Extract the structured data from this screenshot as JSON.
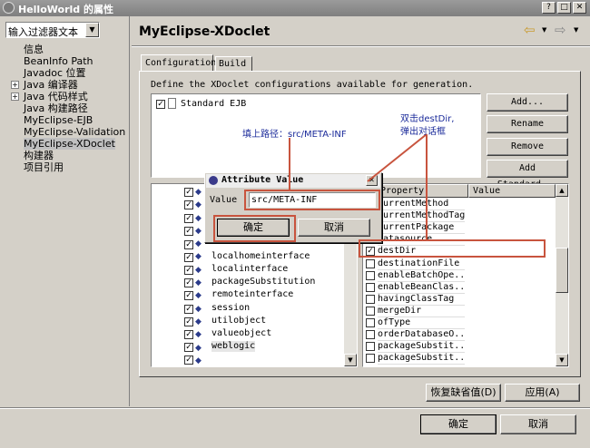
{
  "window": {
    "title": "HelloWorld 的属性"
  },
  "filter": {
    "value": "输入过滤器文本"
  },
  "nav": {
    "items": [
      "信息",
      "BeanInfo Path",
      "Javadoc 位置",
      "Java 编译器",
      "Java 代码样式",
      "Java 构建路径",
      "MyEclipse-EJB",
      "MyEclipse-Validation",
      "MyEclipse-XDoclet",
      "构建器",
      "项目引用"
    ]
  },
  "page": {
    "title": "MyEclipse-XDoclet"
  },
  "tabs": {
    "configuration": "Configuration",
    "build": "Build"
  },
  "main": {
    "description": "Define the XDoclet configurations available for generation.",
    "config_item": "Standard EJB",
    "buttons": {
      "add": "Add...",
      "rename": "Rename",
      "remove": "Remove",
      "add_standard": "Add Standard..."
    }
  },
  "left_list": {
    "items": [
      "localhomeinterface",
      "localinterface",
      "packageSubstitution",
      "remoteinterface",
      "session",
      "utilobject",
      "valueobject",
      "weblogic"
    ]
  },
  "props": {
    "header_property": "Property",
    "header_value": "Value",
    "rows": [
      "currentMethod",
      "currentMethodTag",
      "currentPackage",
      "datasource",
      "destDir",
      "destinationFile",
      "enableBatchOpe...",
      "enableBeanClas...",
      "havingClassTag",
      "mergeDir",
      "ofType",
      "orderDatabaseO...",
      "packageSubstit...",
      "packageSubstit..."
    ]
  },
  "dialog": {
    "title": "Attribute Value",
    "label": "Value :",
    "value": "src/META-INF",
    "ok": "确定",
    "cancel": "取消"
  },
  "annotations": {
    "fill_path": "填上路径：src/META-INF",
    "double_click_1": "双击destDir,",
    "double_click_2": "弹出对话框"
  },
  "footer": {
    "restore_defaults": "恢复缺省值(D)",
    "apply": "应用(A)",
    "ok": "确定",
    "cancel": "取消"
  }
}
